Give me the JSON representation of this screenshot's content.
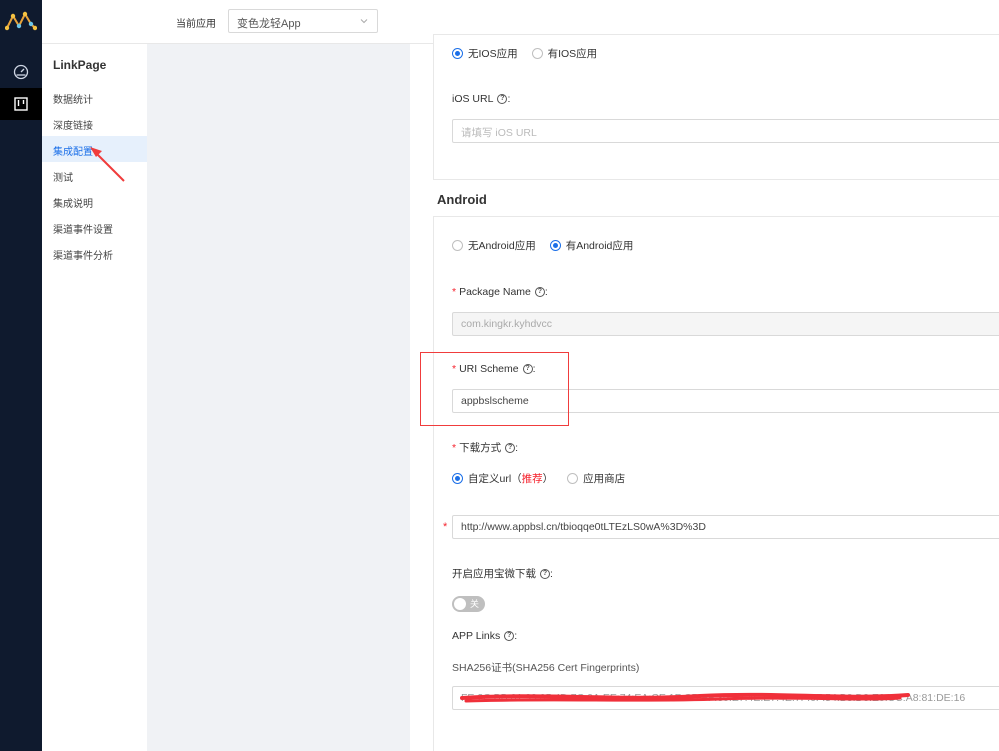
{
  "colors": {
    "rail_bg": "#0f1a2e",
    "accent": "#1b6fe8",
    "required": "#f5222d",
    "highlight": "#f03c3c"
  },
  "topbar": {
    "app_label": "当前应用",
    "app_value": "变色龙轻App"
  },
  "rail": {
    "icons": [
      "dashboard-icon",
      "board-icon"
    ]
  },
  "sidebar": {
    "title": "LinkPage",
    "items": [
      {
        "label": "数据统计"
      },
      {
        "label": "深度链接"
      },
      {
        "label": "集成配置"
      },
      {
        "label": "测试"
      },
      {
        "label": "集成说明"
      },
      {
        "label": "渠道事件设置"
      },
      {
        "label": "渠道事件分析"
      }
    ]
  },
  "ios": {
    "option_none": "无IOS应用",
    "option_has": "有IOS应用",
    "selected": "option_none",
    "url_label": "iOS URL",
    "url_placeholder": "请填写 iOS URL"
  },
  "android": {
    "title": "Android",
    "option_none": "无Android应用",
    "option_has": "有Android应用",
    "selected": "option_has",
    "package_label": "Package Name",
    "package_value": "com.kingkr.kyhdvcc",
    "scheme_label": "URI Scheme",
    "scheme_value": "appbslscheme",
    "download_label": "下载方式",
    "download_opt_custom": "自定义url",
    "download_opt_recommend": "推荐",
    "download_opt_store": "应用商店",
    "download_url": "http://www.appbsl.cn/tbioqqe0tLTEzLS0wA%3D%3D",
    "yyb_label": "开启应用宝微下载",
    "toggle_text": "关",
    "toggle_on": false,
    "applinks_label": "APP Links",
    "sha_label": "SHA256证书(SHA256 Cert Fingerprints)",
    "sha_value": "FE:2C:BB:01:33:05:4D:7C:0A:EE:74:EA:CE:1F:CB:FF:30:E7:4E:E7:4E:7F:6F:54:B8:D3:E0:CC:A8:81:DE:16"
  }
}
